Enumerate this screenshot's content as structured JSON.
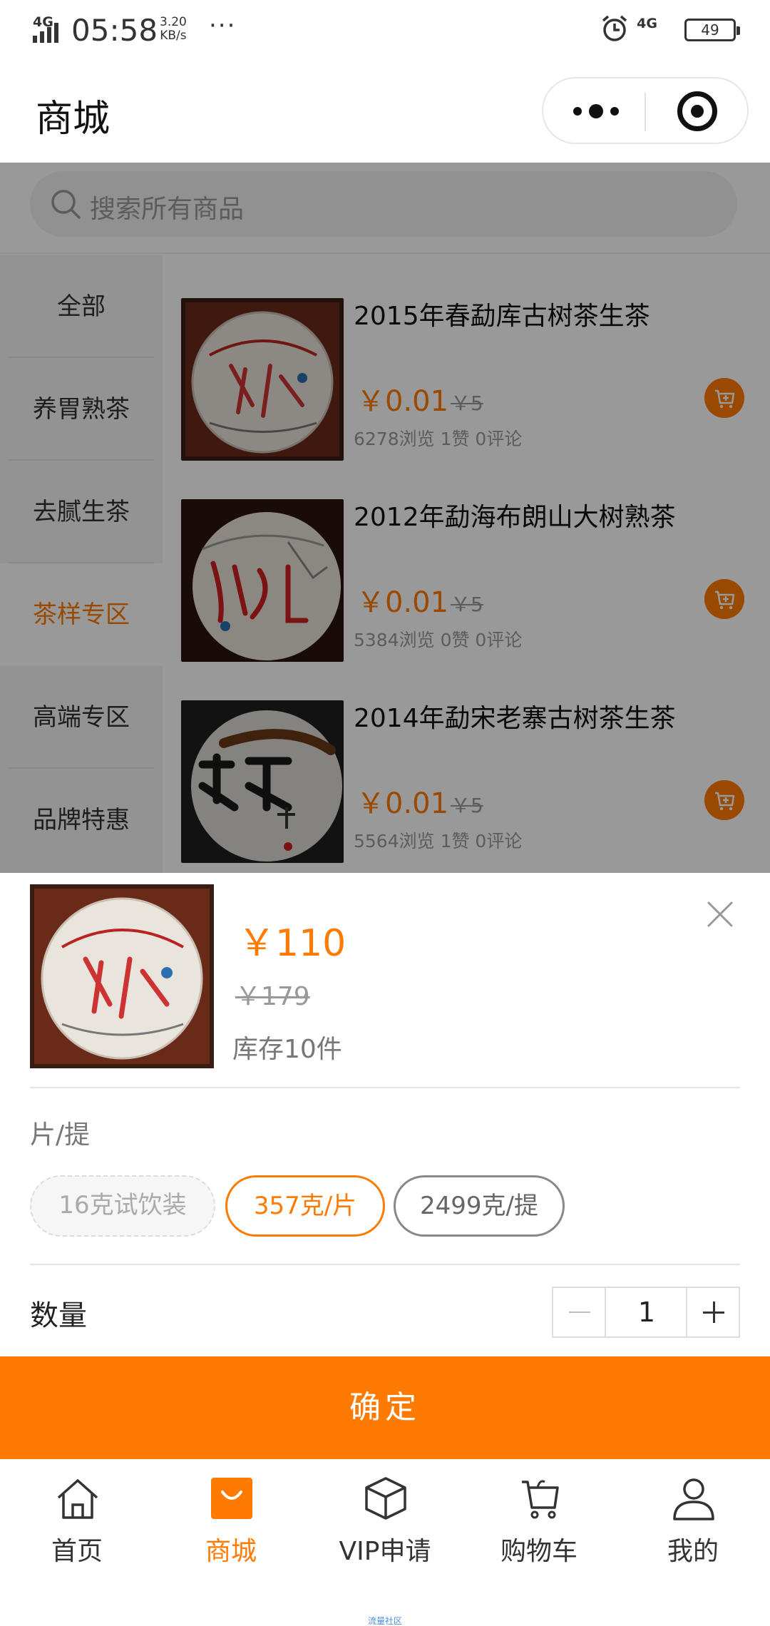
{
  "status_bar": {
    "network": "4G",
    "time": "05:58",
    "speed_value": "3.20",
    "speed_unit": "KB/s",
    "dots": "···",
    "network_right": "4G",
    "battery": "49"
  },
  "nav": {
    "title": "商城"
  },
  "search": {
    "placeholder": "搜索所有商品"
  },
  "categories": [
    {
      "label": "全部"
    },
    {
      "label": "养胃熟茶"
    },
    {
      "label": "去腻生茶"
    },
    {
      "label": "茶样专区",
      "active": true
    },
    {
      "label": "高端专区"
    },
    {
      "label": "品牌特惠"
    }
  ],
  "products": [
    {
      "name": "2015年春勐库古树茶生茶",
      "price": "￥0.01",
      "old_price": "￥5",
      "stats": "6278浏览  1赞  0评论"
    },
    {
      "name": "2012年勐海布朗山大树熟茶",
      "price": "￥0.01",
      "old_price": "￥5",
      "stats": "5384浏览  0赞  0评论"
    },
    {
      "name": "2014年勐宋老寨古树茶生茶",
      "price": "￥0.01",
      "old_price": "￥5",
      "stats": "5564浏览  1赞  0评论"
    }
  ],
  "sku": {
    "price": "￥110",
    "old_price": "￥179",
    "stock": "库存10件",
    "spec_label": "片/提",
    "options": [
      "16克试饮装",
      "357克/片",
      "2499克/提"
    ],
    "selected_option": "357克/片",
    "quantity_label": "数量",
    "quantity": "1",
    "confirm": "确定"
  },
  "tabs": [
    {
      "label": "首页",
      "icon": "home-icon"
    },
    {
      "label": "商城",
      "icon": "shopping-bag-icon",
      "active": true
    },
    {
      "label": "VIP申请",
      "icon": "cube-icon"
    },
    {
      "label": "购物车",
      "icon": "cart-icon"
    },
    {
      "label": "我的",
      "icon": "user-icon"
    }
  ],
  "watermark": "流量社区",
  "colors": {
    "accent": "#ff7a00",
    "overlay": "rgba(0,0,0,0.40)"
  }
}
